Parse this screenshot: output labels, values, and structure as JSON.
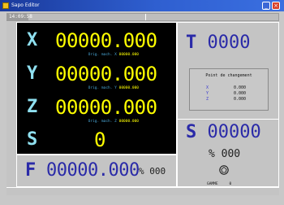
{
  "window": {
    "title": "Sapo Editor",
    "minimize_label": "_",
    "close_label": "×"
  },
  "clock": "14:09:58",
  "axes": [
    {
      "letter": "X",
      "value": "00000.000",
      "orig_label": "Orig. mach. X",
      "orig_value": "00000.000"
    },
    {
      "letter": "Y",
      "value": "00000.000",
      "orig_label": "Orig. mach. Y",
      "orig_value": "00000.000"
    },
    {
      "letter": "Z",
      "value": "00000.000",
      "orig_label": "Orig. mach. Z",
      "orig_value": "00000.000"
    },
    {
      "letter": "S",
      "value": "0"
    }
  ],
  "feed": {
    "letter": "F",
    "value": "00000.000",
    "percent_symbol": "%",
    "percent_value": "000"
  },
  "tool": {
    "letter": "T",
    "value": "0000"
  },
  "change_point": {
    "title": "Point de changement",
    "rows": [
      {
        "axis": "X",
        "value": "0.000"
      },
      {
        "axis": "Y",
        "value": "0.000"
      },
      {
        "axis": "Z",
        "value": "0.000"
      }
    ]
  },
  "spindle": {
    "letter": "S",
    "value": "00000",
    "percent_symbol": "%",
    "percent_value": "000",
    "stop_icon": "spindle-stop-icon"
  },
  "gamme": {
    "label": "GAMME",
    "value": "0"
  },
  "colors": {
    "axis_value": "#ffff00",
    "axis_letter": "#8fe0f0",
    "blue_text": "#2a2aa8",
    "titlebar": "#2f5fd0"
  }
}
